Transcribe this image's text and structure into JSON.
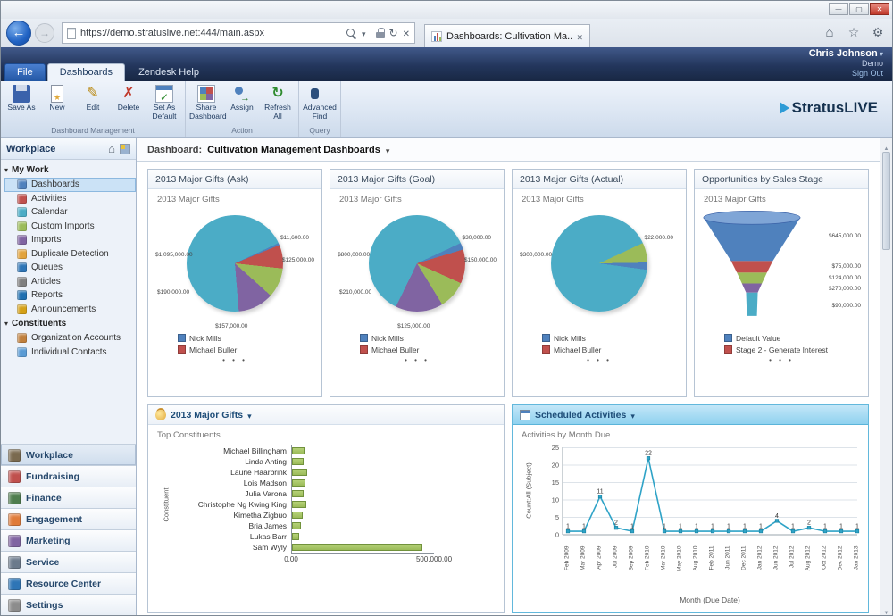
{
  "browser": {
    "url": "https://demo.stratuslive.net:444/main.aspx",
    "tab_title": "Dashboards: Cultivation Ma...",
    "icons": [
      "back-arrow",
      "forward-arrow",
      "page",
      "search",
      "lock",
      "refresh",
      "stop",
      "bar-chart-favicon",
      "home",
      "favorites-star",
      "tools-gear"
    ]
  },
  "crm_header": {
    "user_name": "Chris Johnson",
    "org": "Demo",
    "sign_out": "Sign Out",
    "logo_text": "StratusLIVE",
    "tabs": [
      {
        "label": "File",
        "active": false,
        "file_tab": true
      },
      {
        "label": "Dashboards",
        "active": true,
        "file_tab": false
      },
      {
        "label": "Zendesk Help",
        "active": false,
        "file_tab": false
      }
    ]
  },
  "ribbon": {
    "groups": [
      {
        "label": "Dashboard Management",
        "buttons": [
          "Save As",
          "New",
          "Edit",
          "Delete",
          "Set As Default"
        ]
      },
      {
        "label": "Action",
        "buttons": [
          "Share Dashboard",
          "Assign",
          "Refresh All"
        ]
      },
      {
        "label": "Query",
        "buttons": [
          "Advanced Find"
        ]
      }
    ]
  },
  "sidebar": {
    "title": "Workplace",
    "sections": [
      {
        "label": "My Work",
        "selected": "Dashboards",
        "items": [
          "Dashboards",
          "Activities",
          "Calendar",
          "Custom Imports",
          "Imports",
          "Duplicate Detection",
          "Queues",
          "Articles",
          "Reports",
          "Announcements"
        ]
      },
      {
        "label": "Constituents",
        "selected": "",
        "items": [
          "Organization Accounts",
          "Individual Contacts"
        ]
      }
    ],
    "bottom_nav": [
      "Workplace",
      "Fundraising",
      "Finance",
      "Engagement",
      "Marketing",
      "Service",
      "Resource Center",
      "Settings"
    ],
    "active_nav": "Workplace"
  },
  "dashboard": {
    "label": "Dashboard:",
    "name": "Cultivation Management Dashboards"
  },
  "chart_data": [
    {
      "type": "pie",
      "title": "2013 Major Gifts (Ask)",
      "subtitle": "2013 Major Gifts",
      "slices": [
        {
          "label": "$1,095,000.00",
          "value": 1095000,
          "color": "#4BACC6"
        },
        {
          "label": "$11,600.00",
          "value": 11600,
          "color": "#4F81BD"
        },
        {
          "label": "$125,000.00",
          "value": 125000,
          "color": "#C0504D"
        },
        {
          "label": "$157,000.00",
          "value": 157000,
          "color": "#9BBB59"
        },
        {
          "label": "$190,000.00",
          "value": 190000,
          "color": "#8064A2"
        }
      ],
      "legend": [
        {
          "label": "Nick Mills",
          "color": "#4F81BD"
        },
        {
          "label": "Michael Buller",
          "color": "#C0504D"
        }
      ],
      "legend_more": "• • •"
    },
    {
      "type": "pie",
      "title": "2013 Major Gifts (Goal)",
      "subtitle": "2013 Major Gifts",
      "slices": [
        {
          "label": "$800,000.00",
          "value": 800000,
          "color": "#4BACC6"
        },
        {
          "label": "$30,000.00",
          "value": 30000,
          "color": "#4F81BD"
        },
        {
          "label": "$150,000.00",
          "value": 150000,
          "color": "#C0504D"
        },
        {
          "label": "$125,000.00",
          "value": 125000,
          "color": "#9BBB59"
        },
        {
          "label": "$210,000.00",
          "value": 210000,
          "color": "#8064A2"
        }
      ],
      "legend": [
        {
          "label": "Nick Mills",
          "color": "#4F81BD"
        },
        {
          "label": "Michael Buller",
          "color": "#C0504D"
        }
      ],
      "legend_more": "• • •"
    },
    {
      "type": "pie",
      "title": "2013 Major Gifts (Actual)",
      "subtitle": "2013 Major Gifts",
      "slices": [
        {
          "label": "$300,000.00",
          "value": 300000,
          "color": "#4BACC6"
        },
        {
          "label": "$22,000.00",
          "value": 22000,
          "color": "#9BBB59"
        },
        {
          "label": "",
          "value": 8000,
          "color": "#4F81BD"
        }
      ],
      "legend": [
        {
          "label": "Nick Mills",
          "color": "#4F81BD"
        },
        {
          "label": "Michael Buller",
          "color": "#C0504D"
        }
      ],
      "legend_more": "• • •"
    },
    {
      "type": "funnel",
      "title": "Opportunities by Sales Stage",
      "subtitle": "2013 Major Gifts",
      "segments": [
        {
          "label": "$645,000.00",
          "value": 645000,
          "color": "#4F81BD"
        },
        {
          "label": "$75,000.00",
          "value": 75000,
          "color": "#C0504D"
        },
        {
          "label": "$124,000.00",
          "value": 124000,
          "color": "#9BBB59"
        },
        {
          "label": "$270,000.00",
          "value": 270000,
          "color": "#8064A2"
        },
        {
          "label": "$90,000.00",
          "value": 90000,
          "color": "#4BACC6"
        }
      ],
      "legend": [
        {
          "label": "Default Value",
          "color": "#4F81BD"
        },
        {
          "label": "Stage 2 - Generate Interest",
          "color": "#C0504D"
        }
      ],
      "legend_more": "• • •"
    },
    {
      "type": "bar",
      "title": "2013 Major Gifts",
      "subtitle": "Top Constituents",
      "orientation": "horizontal",
      "ylabel": "Constituent",
      "categories": [
        "Michael Billingham",
        "Linda Ahting",
        "Laurie Haarbrink",
        "Lois Madson",
        "Julia Varona",
        "Christophe Ng Kwing King",
        "Kimetha Zigbuo",
        "Bria James",
        "Lukas Barr",
        "Sam Wyly"
      ],
      "values": [
        45000,
        40000,
        52000,
        46000,
        42000,
        50000,
        38000,
        32000,
        26000,
        455000
      ],
      "xlim": [
        0,
        500000
      ],
      "xticks": [
        "0.00",
        "500,000.00"
      ],
      "color": "#9BBB59"
    },
    {
      "type": "line",
      "title": "Scheduled Activities",
      "subtitle": "Activities by Month Due",
      "xlabel": "Month (Due Date)",
      "ylabel": "Count:All (Subject)",
      "x": [
        "Feb 2009",
        "Mar 2009",
        "Apr 2009",
        "Jul 2009",
        "Sep 2009",
        "Feb 2010",
        "Mar 2010",
        "May 2010",
        "Aug 2010",
        "Feb 2011",
        "Jun 2011",
        "Dec 2011",
        "Jan 2012",
        "Jun 2012",
        "Jul 2012",
        "Aug 2012",
        "Oct 2012",
        "Dec 2012",
        "Jan 2013"
      ],
      "values": [
        1,
        1,
        11,
        2,
        1,
        22,
        1,
        1,
        1,
        1,
        1,
        1,
        1,
        4,
        1,
        2,
        1,
        1,
        1
      ],
      "ylim": [
        0,
        25
      ],
      "yticks": [
        0,
        5,
        10,
        15,
        20,
        25
      ],
      "legend_position": "none",
      "grid": true,
      "color": "#2FA3C7"
    }
  ]
}
